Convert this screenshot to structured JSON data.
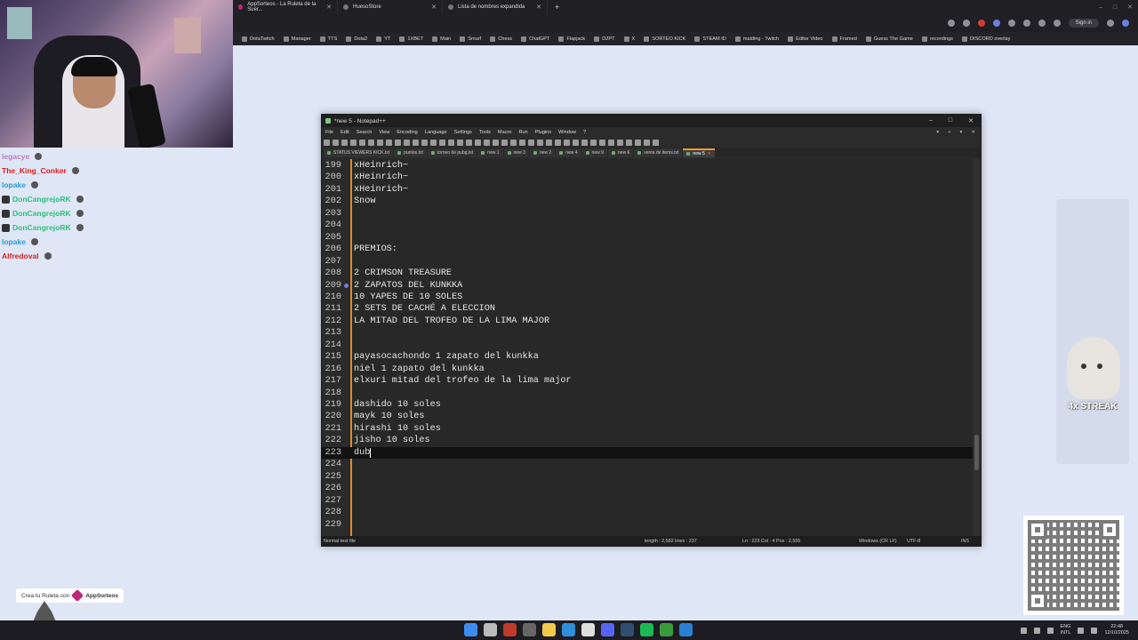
{
  "browser": {
    "tabs": [
      {
        "label": "AppSorteos - La Ruleta de la Suer...",
        "dot": "#c0267a"
      },
      {
        "label": "HuesoStore",
        "dot": "#777777"
      },
      {
        "label": "Lista de nombres expandida",
        "dot": "#777777"
      }
    ],
    "sign_in": "Sign in",
    "bookmarks": [
      "DotaTwitch",
      "Manager",
      "TTS",
      "Dota2",
      "YT",
      "1XBET",
      "Main",
      "Smurf",
      "Chess",
      "ChatGPT",
      "Flapjack",
      "D2PT",
      "X",
      "SORTEO KICK",
      "STEAM ID",
      "malding - Twitch",
      "Editor Video",
      "Framed",
      "Guess The Game",
      "recordings",
      "DISCORD overlay"
    ]
  },
  "chat": [
    {
      "user": "legacye",
      "color": "#c07cc0"
    },
    {
      "user": "The_King_Conker",
      "color": "#d61f1f"
    },
    {
      "user": "lopake",
      "color": "#2a9bd6"
    },
    {
      "user": "DonCangrejoRK",
      "color": "#2ec07a"
    },
    {
      "user": "DonCangrejoRK",
      "color": "#2ec07a"
    },
    {
      "user": "DonCangrejoRK",
      "color": "#2ec07a"
    },
    {
      "user": "lopake",
      "color": "#2a9bd6"
    },
    {
      "user": "Alfredoval",
      "color": "#d22323"
    }
  ],
  "notepad": {
    "title": "*new 5 - Notepad++",
    "menu": [
      "File",
      "Edit",
      "Search",
      "View",
      "Encoding",
      "Language",
      "Settings",
      "Tools",
      "Macro",
      "Run",
      "Plugins",
      "Window",
      "?"
    ],
    "tabs": [
      "STATUS VIEWERS KICK.txt",
      "puntos.txt",
      "torneo de pubg.txt",
      "new 1",
      "new 3",
      "new 2",
      "new 4",
      "new 9",
      "new 6",
      "venta de items.txt",
      "new 5"
    ],
    "active_tab": "new 5",
    "lines": [
      {
        "n": "199",
        "t": "xHeinrich~"
      },
      {
        "n": "200",
        "t": "xHeinrich~"
      },
      {
        "n": "201",
        "t": "xHeinrich~"
      },
      {
        "n": "202",
        "t": "Snow"
      },
      {
        "n": "203",
        "t": ""
      },
      {
        "n": "204",
        "t": ""
      },
      {
        "n": "205",
        "t": ""
      },
      {
        "n": "206",
        "t": "PREMIOS:"
      },
      {
        "n": "207",
        "t": ""
      },
      {
        "n": "208",
        "t": "2 CRIMSON TREASURE"
      },
      {
        "n": "209",
        "t": "2 ZAPATOS DEL KUNKKA"
      },
      {
        "n": "210",
        "t": "10 YAPES DE 10 SOLES"
      },
      {
        "n": "211",
        "t": "2 SETS DE CACHÉ A ELECCION"
      },
      {
        "n": "212",
        "t": "LA MITAD DEL TROFEO DE LA LIMA MAJOR"
      },
      {
        "n": "213",
        "t": ""
      },
      {
        "n": "214",
        "t": ""
      },
      {
        "n": "215",
        "t": "payasocachondo 1 zapato del kunkka"
      },
      {
        "n": "216",
        "t": "niel 1 zapato del kunkka"
      },
      {
        "n": "217",
        "t": "elxuri mitad del trofeo de la lima major"
      },
      {
        "n": "218",
        "t": ""
      },
      {
        "n": "219",
        "t": "dashido 10 soles"
      },
      {
        "n": "220",
        "t": "mayk 10 soles"
      },
      {
        "n": "221",
        "t": "hirashi 10 soles"
      },
      {
        "n": "222",
        "t": "jisho 10 soles"
      },
      {
        "n": "223",
        "t": "dub"
      },
      {
        "n": "224",
        "t": ""
      },
      {
        "n": "225",
        "t": ""
      },
      {
        "n": "226",
        "t": ""
      },
      {
        "n": "227",
        "t": ""
      },
      {
        "n": "228",
        "t": ""
      },
      {
        "n": "229",
        "t": ""
      }
    ],
    "current_line": "223",
    "bookmark_line": "209",
    "status": {
      "type": "Normal text file",
      "length": "length : 2,582   lines : 237",
      "pos": "Ln : 223   Col : 4   Pos : 2,555",
      "eol": "Windows (CR LF)",
      "encoding": "UTF-8",
      "mode": "INS"
    }
  },
  "overlay": {
    "streak": "4x STREAK",
    "promo_text": "Crea tu Ruleta con",
    "promo_brand": "AppSorteos"
  },
  "taskbar": {
    "lang1": "ENG",
    "lang2": "INTL",
    "time": "22:48",
    "date": "12/10/2025"
  }
}
